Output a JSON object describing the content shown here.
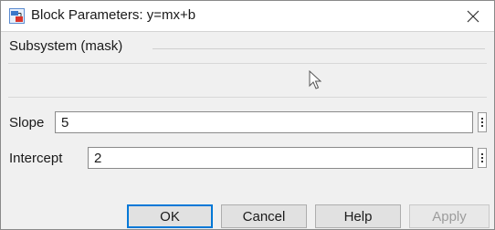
{
  "window": {
    "title": "Block Parameters: y=mx+b",
    "icon": "simulink-block-icon",
    "close_icon": "close-icon"
  },
  "group": {
    "label": "Subsystem (mask)"
  },
  "parameters": [
    {
      "label": "Slope",
      "value": "5"
    },
    {
      "label": "Intercept",
      "value": "2"
    }
  ],
  "buttons": {
    "ok": "OK",
    "cancel": "Cancel",
    "help": "Help",
    "apply": "Apply"
  },
  "colors": {
    "accent": "#0078d7",
    "dialog_background": "#f0f0f0"
  }
}
